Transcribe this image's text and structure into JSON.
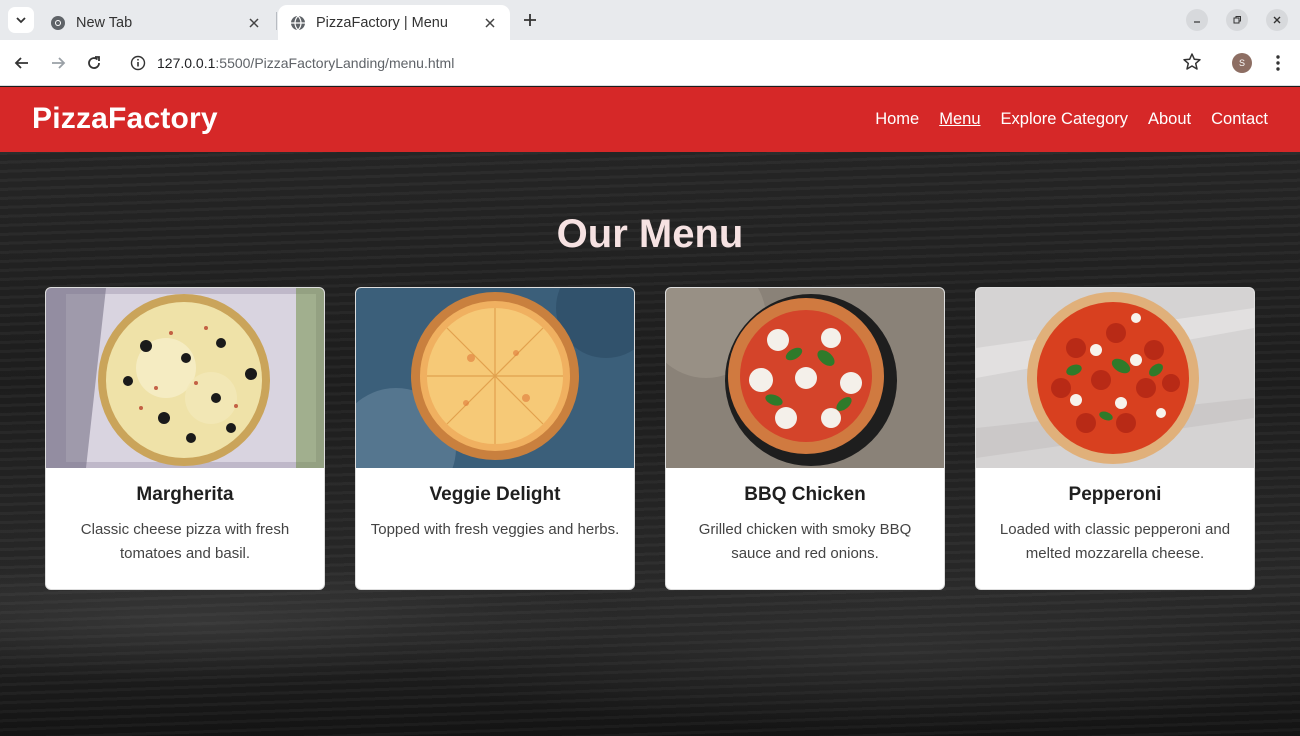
{
  "browser": {
    "tabs": [
      {
        "title": "New Tab",
        "active": false
      },
      {
        "title": "PizzaFactory | Menu",
        "active": true
      }
    ],
    "url_host": "127.0.0.1",
    "url_rest": ":5500/PizzaFactoryLanding/menu.html",
    "profile_initial": "S"
  },
  "site": {
    "brand": "PizzaFactory",
    "nav": [
      "Home",
      "Menu",
      "Explore Category",
      "About",
      "Contact"
    ],
    "current_nav": "Menu",
    "accent_color": "#d62828"
  },
  "menu": {
    "title": "Our Menu",
    "items": [
      {
        "name": "Margherita",
        "description": "Classic cheese pizza with fresh tomatoes and basil."
      },
      {
        "name": "Veggie Delight",
        "description": "Topped with fresh veggies and herbs."
      },
      {
        "name": "BBQ Chicken",
        "description": "Grilled chicken with smoky BBQ sauce and red onions."
      },
      {
        "name": "Pepperoni",
        "description": "Loaded with classic pepperoni and melted mozzarella cheese."
      }
    ]
  }
}
